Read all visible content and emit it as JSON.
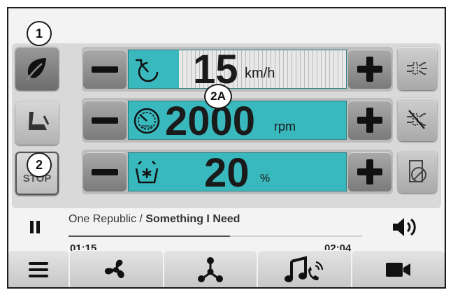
{
  "callouts": {
    "one": "1",
    "two": "2",
    "two_a": "2A"
  },
  "sidebar": {
    "stop_label": "STOP",
    "stop_partial": "O"
  },
  "rows": {
    "speed": {
      "value": "15",
      "unit": "km/h",
      "fill_fraction": 0.23
    },
    "engine": {
      "value": "2000",
      "unit": "rpm",
      "icon_label": "RPM"
    },
    "pto": {
      "value": "20",
      "unit": "%"
    }
  },
  "media": {
    "artist": "One Republic",
    "separator": "/",
    "title": "Something I Need",
    "elapsed": "01:15",
    "total": "02:04",
    "progress_fraction": 0.55
  },
  "icons": {
    "eco": "leaf-icon",
    "seat": "seat-icon",
    "pause": "pause-icon",
    "volume": "volume-icon",
    "menu": "menu-icon",
    "fan": "fan-icon",
    "connect": "network-icon",
    "music": "music-phone-icon",
    "camera": "camera-icon"
  },
  "colors": {
    "accent": "#39b8bd"
  }
}
